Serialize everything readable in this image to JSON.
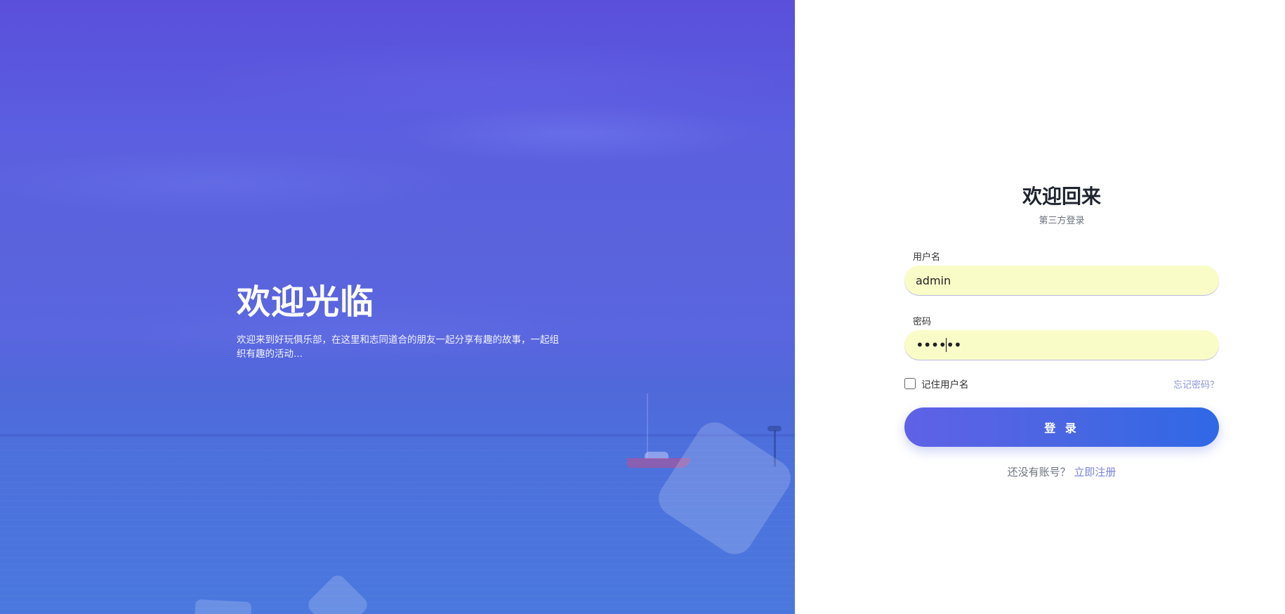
{
  "hero": {
    "title": "欢迎光临",
    "description": "欢迎来到好玩俱乐部，在这里和志同道合的朋友一起分享有趣的故事，一起组织有趣的活动..."
  },
  "login": {
    "title": "欢迎回来",
    "subtitle": "第三方登录",
    "username_label": "用户名",
    "username_value": "admin",
    "password_label": "密码",
    "password_masked": "••••••",
    "remember_label": "记住用户名",
    "forgot_label": "忘记密码？",
    "submit_label": "登 录",
    "register_prompt": "还没有账号？",
    "register_link": "立即注册"
  },
  "colors": {
    "hero_gradient_top": "#5a4fdb",
    "hero_gradient_bottom": "#4a78de",
    "input_autofill_bg": "#fafcc8",
    "button_start": "#5f61e6",
    "button_end": "#2f68e6",
    "link": "#7882d8"
  }
}
